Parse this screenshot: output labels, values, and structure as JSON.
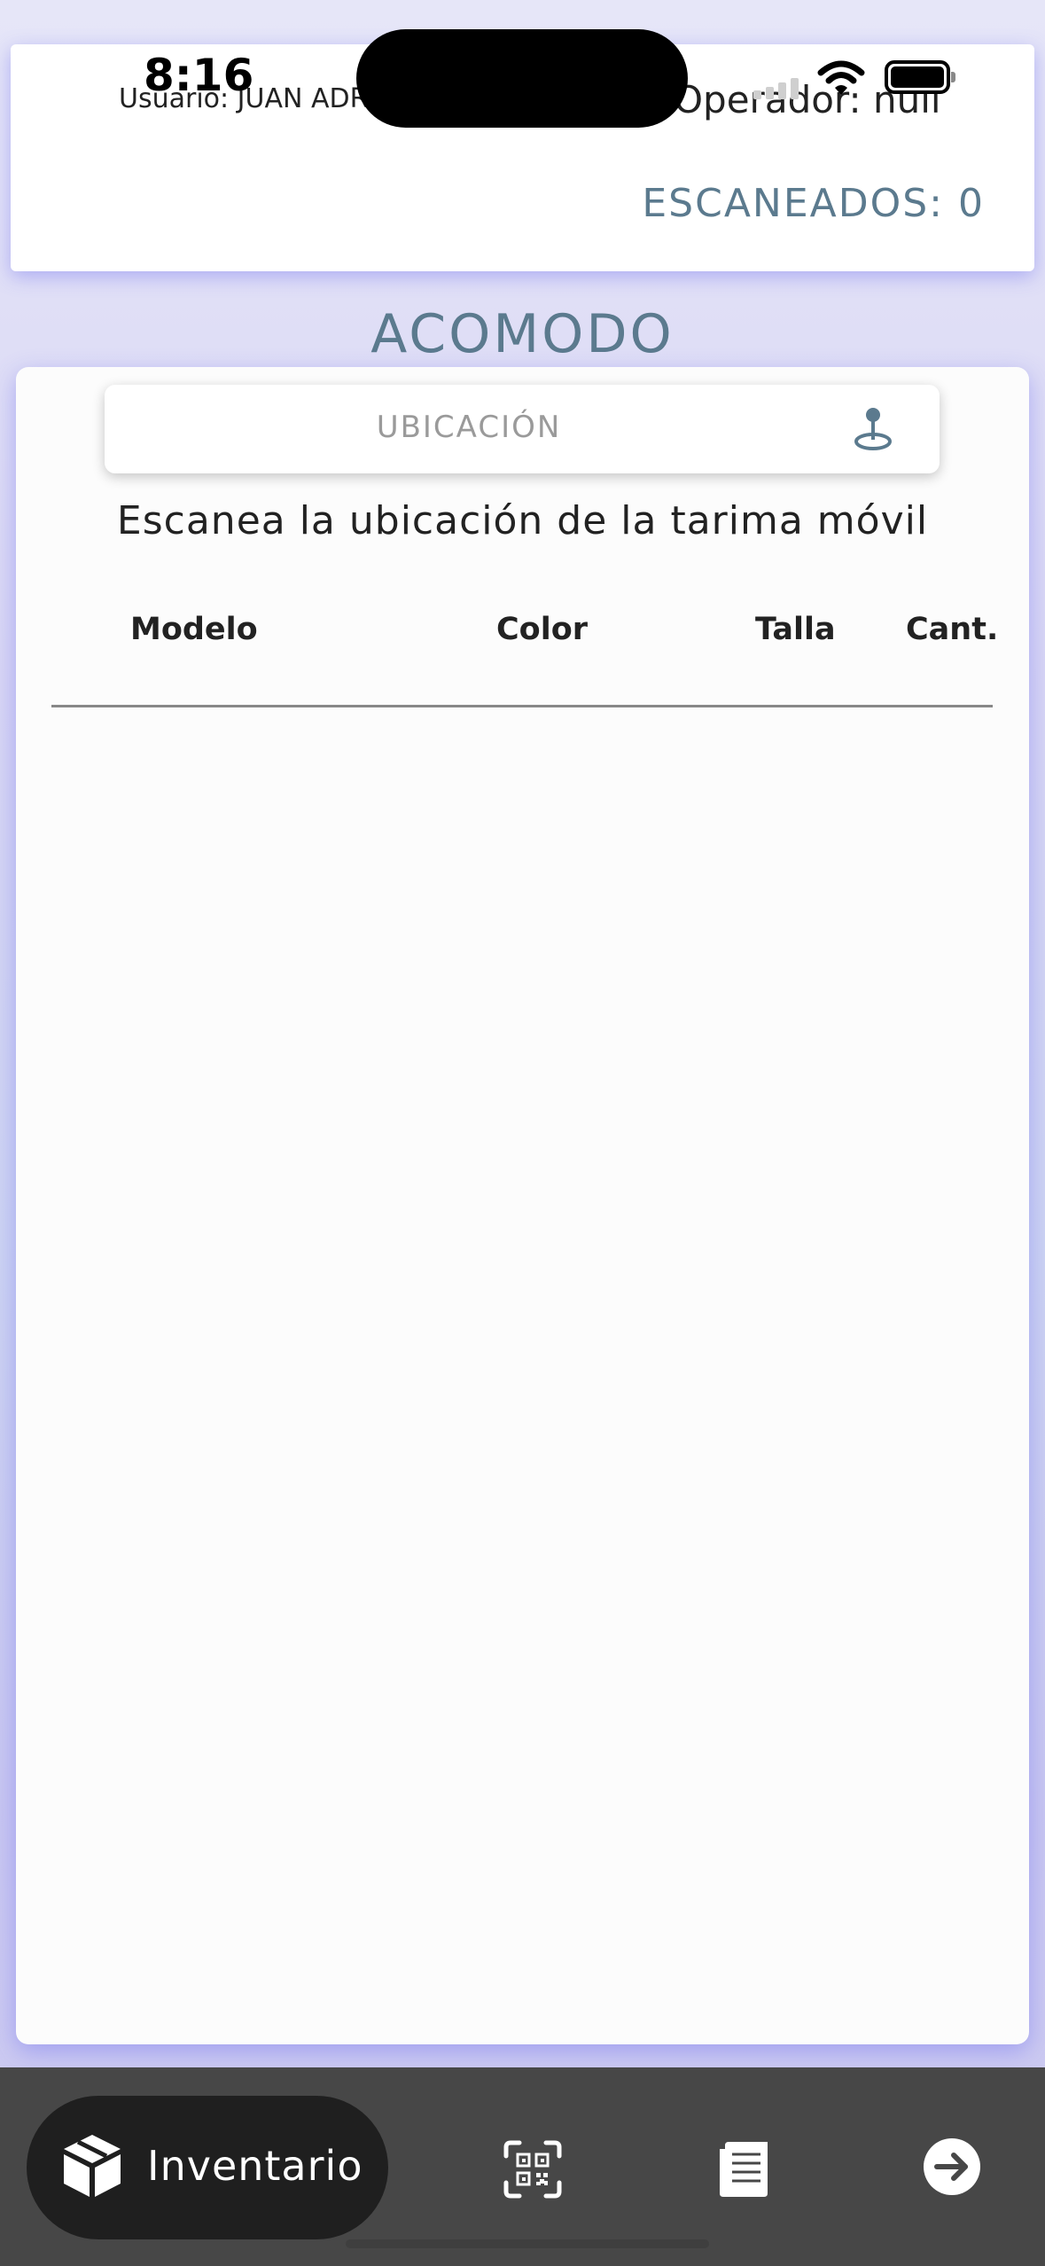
{
  "status_bar": {
    "time": "8:16"
  },
  "header": {
    "user": "Usuario: JUAN ADR",
    "operator": "Operador: null",
    "scanned": "ESCANEADOS: 0"
  },
  "screen": {
    "title": "ACOMODO"
  },
  "location": {
    "placeholder": "UBICACIÓN",
    "icon": "location-pin-icon",
    "instruction": "Escanea la ubicación de la tarima móvil"
  },
  "table": {
    "columns": [
      "Modelo",
      "Color",
      "Talla",
      "Cant."
    ],
    "rows": []
  },
  "bottom_nav": {
    "active_label": "Inventario",
    "items": [
      {
        "label": "Inventario",
        "icon": "box-icon",
        "active": true
      },
      {
        "icon": "qr-scan-icon"
      },
      {
        "icon": "document-icon"
      },
      {
        "icon": "arrow-right-icon"
      }
    ]
  },
  "colors": {
    "accent": "#5b7a8e",
    "nav_background": "#474747",
    "nav_active": "#1f1f1f",
    "background_tint": "#d8d6f4"
  }
}
